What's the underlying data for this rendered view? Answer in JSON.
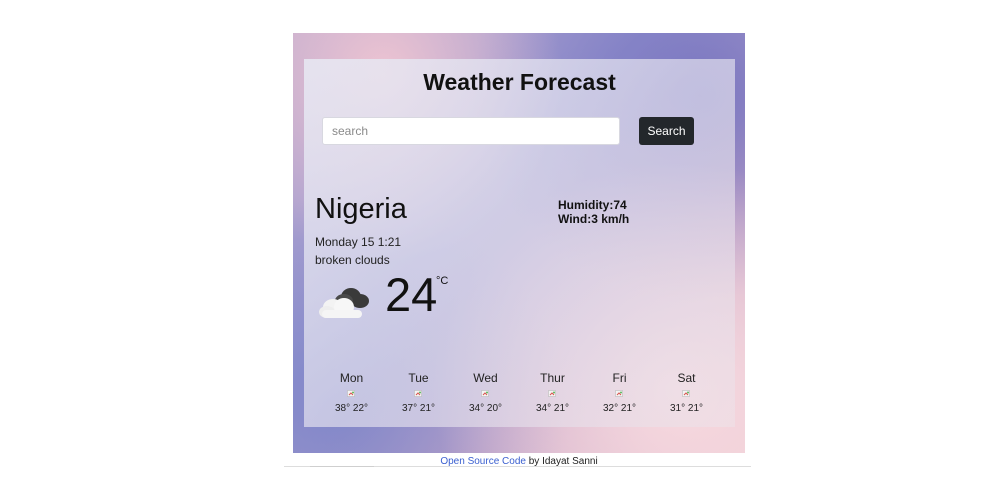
{
  "app": {
    "title": "Weather Forecast"
  },
  "search": {
    "placeholder": "search",
    "value": "",
    "button_label": "Search"
  },
  "current": {
    "city": "Nigeria",
    "humidity": "Humidity:74",
    "wind": "Wind:3 km/h",
    "date": "Monday 15 1:21",
    "description": "broken clouds",
    "temperature": "24",
    "unit": "°C",
    "icon": "broken-clouds-icon"
  },
  "forecast": [
    {
      "day": "Mon",
      "temps": "38° 22°",
      "icon": "broken-image-icon"
    },
    {
      "day": "Tue",
      "temps": "37° 21°",
      "icon": "broken-image-icon"
    },
    {
      "day": "Wed",
      "temps": "34° 20°",
      "icon": "broken-image-icon"
    },
    {
      "day": "Thur",
      "temps": "34° 21°",
      "icon": "broken-image-icon"
    },
    {
      "day": "Fri",
      "temps": "32° 21°",
      "icon": "broken-image-icon"
    },
    {
      "day": "Sat",
      "temps": "31° 21°",
      "icon": "broken-image-icon"
    }
  ],
  "footer": {
    "link_text": "Open Source Code",
    "credit": " by Idayat Sanni"
  },
  "colors": {
    "button_bg": "#23272b",
    "link": "#3a5fd0"
  }
}
